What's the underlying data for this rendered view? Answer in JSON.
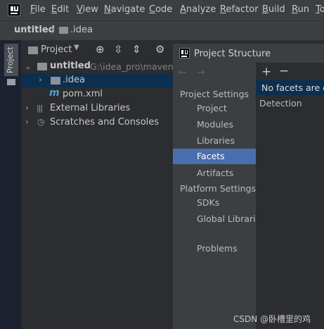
{
  "menu": [
    "File",
    "Edit",
    "View",
    "Navigate",
    "Code",
    "Analyze",
    "Refactor",
    "Build",
    "Run",
    "To"
  ],
  "breadcrumb": {
    "project": "untitled",
    "folder": ".idea"
  },
  "tool_stripe": {
    "label": "Project"
  },
  "project_panel": {
    "title": "Project",
    "tree": {
      "root": {
        "name": "untitled",
        "path": "G:\\idea_pro\\maven\\u"
      },
      "idea_folder": ".idea",
      "pom": "pom.xml",
      "pom_icon_letter": "m",
      "external_libraries": "External Libraries",
      "scratches": "Scratches and Consoles"
    }
  },
  "dialog": {
    "title": "Project Structure",
    "sections": {
      "project_settings": "Project Settings",
      "platform_settings": "Platform Settings"
    },
    "items": {
      "project": "Project",
      "modules": "Modules",
      "libraries": "Libraries",
      "facets": "Facets",
      "artifacts": "Artifacts",
      "sdks": "SDKs",
      "global_libraries": "Global Librarie",
      "problems": "Problems"
    },
    "selected_item": "Facets",
    "content": {
      "add": "+",
      "remove": "−",
      "facets_list": "No facets are c",
      "detection": "Detection"
    }
  },
  "watermark": "CSDN @卧槽里的鸡",
  "colors": {
    "selection": "#4b6eaf",
    "tree_selection": "#0d2f4f",
    "menu_bg": "#3c3f41",
    "panel_bg": "#2b2d30"
  }
}
